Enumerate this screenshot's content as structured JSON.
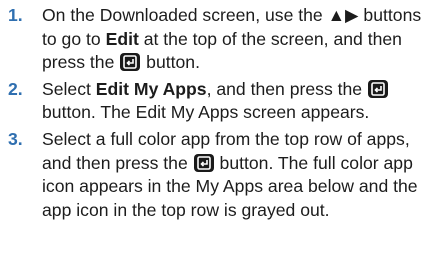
{
  "steps": [
    {
      "number": "1.",
      "part1": "On the Downloaded screen, use the ",
      "arrows": "▲▶",
      "part2": " buttons to go to ",
      "bold1": "Edit",
      "part3": " at the top of the screen, and then press the ",
      "part4": " button."
    },
    {
      "number": "2.",
      "part1": "Select ",
      "bold1": "Edit My Apps",
      "part2": ", and then press the ",
      "part3": " button. The Edit My Apps screen appears."
    },
    {
      "number": "3.",
      "part1": "Select a full color app from the top row of apps, and then press the ",
      "part2": " button. The full color app icon appears in the My Apps area below and the app icon in the top row is grayed out."
    }
  ],
  "icons": {
    "enter": "enter-button-icon"
  },
  "colors": {
    "step_number": "#2f6fb0",
    "text": "#1c1c1c",
    "icon_bg": "#1a1a1a"
  }
}
